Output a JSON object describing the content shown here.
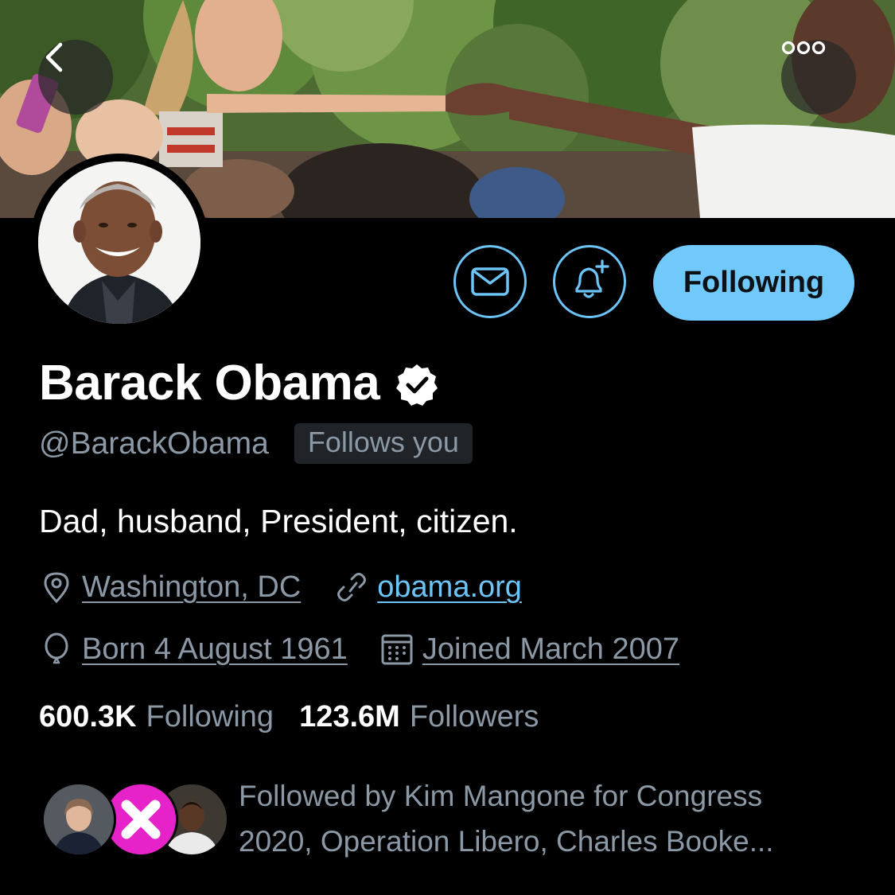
{
  "header": {
    "back_icon": "chevron-left-icon",
    "more_icon": "more-horizontal-icon"
  },
  "actions": {
    "message_icon": "mail-icon",
    "notify_icon": "bell-plus-icon",
    "following_label": "Following",
    "accent_color": "#71c8fb"
  },
  "profile": {
    "name": "Barack Obama",
    "verified": true,
    "handle": "@BarackObama",
    "follows_you": "Follows you",
    "bio": "Dad, husband, President, citizen.",
    "location": "Washington, DC",
    "website": "obama.org",
    "born": "Born 4 August 1961",
    "joined": "Joined March 2007"
  },
  "stats": {
    "following_count": "600.3K",
    "following_label": "Following",
    "followers_count": "123.6M",
    "followers_label": "Followers"
  },
  "followed_by": {
    "text": "Followed by Kim Mangone for Congress 2020, Operation Libero, Charles Booke..."
  }
}
